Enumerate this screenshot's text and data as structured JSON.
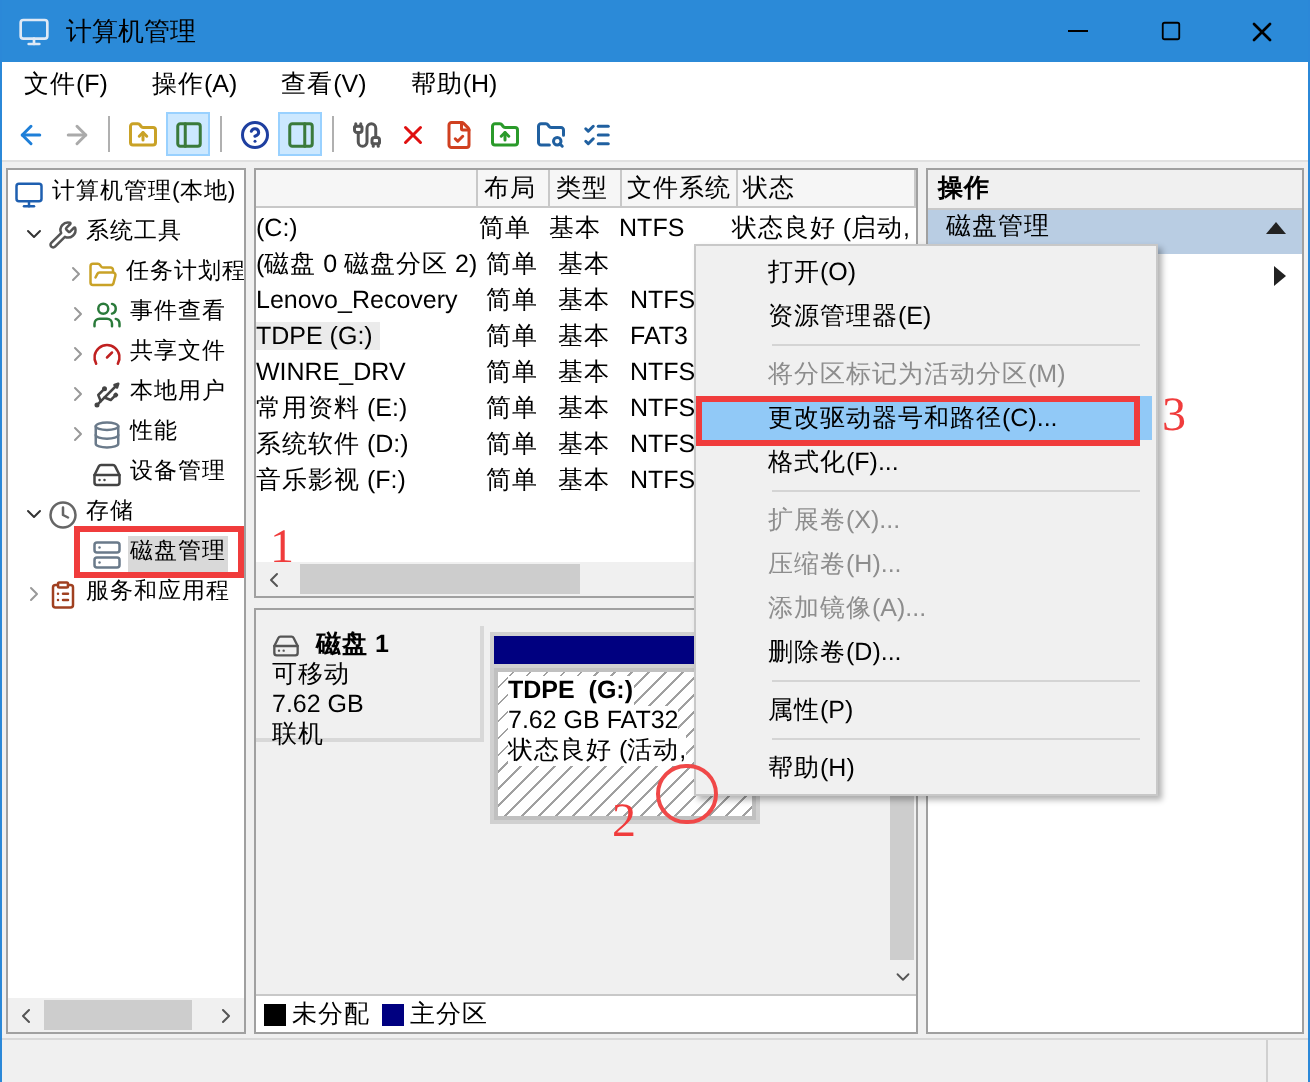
{
  "window": {
    "title": "计算机管理"
  },
  "menu_bar": [
    "文件(F)",
    "操作(A)",
    "查看(V)",
    "帮助(H)"
  ],
  "toolbar": [
    {
      "kind": "button",
      "pressed": false,
      "disabled": false
    },
    {
      "kind": "button",
      "pressed": false,
      "disabled": true
    },
    {
      "kind": "separator"
    },
    {
      "kind": "button",
      "pressed": false,
      "disabled": false
    },
    {
      "kind": "button",
      "pressed": true,
      "disabled": false
    },
    {
      "kind": "separator"
    },
    {
      "kind": "button",
      "pressed": false,
      "disabled": false
    },
    {
      "kind": "button",
      "pressed": true,
      "disabled": false
    },
    {
      "kind": "separator"
    },
    {
      "kind": "button",
      "pressed": false,
      "disabled": false
    },
    {
      "kind": "button",
      "pressed": false,
      "disabled": false
    },
    {
      "kind": "button",
      "pressed": false,
      "disabled": false
    },
    {
      "kind": "button",
      "pressed": false,
      "disabled": false
    },
    {
      "kind": "button",
      "pressed": false,
      "disabled": false
    },
    {
      "kind": "button",
      "pressed": false,
      "disabled": false
    }
  ],
  "tree": [
    {
      "label": "计算机管理(本地)",
      "kind": "root",
      "selected": false,
      "children": [
        {
          "label": "系统工具",
          "kind": "branch",
          "expanded": true,
          "selected": false,
          "children": [
            {
              "label": "任务计划程",
              "kind": "branch",
              "expanded": false,
              "selected": false
            },
            {
              "label": "事件查看",
              "kind": "branch",
              "expanded": false,
              "selected": false
            },
            {
              "label": "共享文件",
              "kind": "branch",
              "expanded": false,
              "selected": false
            },
            {
              "label": "本地用户",
              "kind": "branch",
              "expanded": false,
              "selected": false
            },
            {
              "label": "性能",
              "kind": "branch",
              "expanded": false,
              "selected": false
            },
            {
              "label": "设备管理",
              "kind": "leaf",
              "selected": false
            }
          ]
        },
        {
          "label": "存储",
          "kind": "branch",
          "expanded": true,
          "selected": false,
          "children": [
            {
              "label": "磁盘管理",
              "kind": "leaf",
              "selected": true
            }
          ]
        },
        {
          "label": "服务和应用程",
          "kind": "branch",
          "expanded": false,
          "selected": false
        }
      ]
    }
  ],
  "volume_list": {
    "columns": [
      "布局",
      "类型",
      "文件系统",
      "状态"
    ],
    "rows": [
      {
        "name": "(C:)",
        "layout": "简单",
        "type": "基本",
        "file_system": "NTFS",
        "status": "状态良好 (启动,",
        "selected": false
      },
      {
        "name": "(磁盘 0 磁盘分区 2)",
        "layout": "简单",
        "type": "基本",
        "selected": false
      },
      {
        "name": "Lenovo_Recovery",
        "layout": "简单",
        "type": "基本",
        "file_system": "NTFS",
        "selected": false
      },
      {
        "name": "TDPE (G:)",
        "layout": "简单",
        "type": "基本",
        "file_system": "FAT3",
        "selected": true
      },
      {
        "name": "WINRE_DRV",
        "layout": "简单",
        "type": "基本",
        "file_system": "NTFS",
        "selected": false
      },
      {
        "name": "常用资料 (E:)",
        "layout": "简单",
        "type": "基本",
        "file_system": "NTFS",
        "selected": false
      },
      {
        "name": "系统软件 (D:)",
        "layout": "简单",
        "type": "基本",
        "file_system": "NTFS",
        "selected": false
      },
      {
        "name": "音乐影视 (F:)",
        "layout": "简单",
        "type": "基本",
        "file_system": "NTFS",
        "selected": false
      }
    ]
  },
  "disk_view": {
    "disk": {
      "name": "磁盘 1",
      "lines": [
        "可移动",
        "7.62 GB",
        "联机"
      ]
    },
    "partitions": [
      {
        "name": "TDPE  (G:)",
        "lines": [
          "7.62 GB FAT32",
          "状态良好 (活动,"
        ],
        "color": "#000080"
      }
    ],
    "legend": [
      {
        "label": "未分配",
        "color": "#000000"
      },
      {
        "label": "主分区",
        "color": "#000080"
      }
    ]
  },
  "actions": {
    "title": "操作",
    "items": [
      {
        "kind": "section",
        "label": "磁盘管理"
      },
      {
        "kind": "more"
      }
    ]
  },
  "context_menu": [
    {
      "kind": "item",
      "label": "打开(O)",
      "disabled": false,
      "selected": false
    },
    {
      "kind": "item",
      "label": "资源管理器(E)",
      "disabled": false,
      "selected": false
    },
    {
      "kind": "separator"
    },
    {
      "kind": "item",
      "label": "将分区标记为活动分区(M)",
      "disabled": true,
      "selected": false
    },
    {
      "kind": "item",
      "label": "更改驱动器号和路径(C)...",
      "disabled": false,
      "selected": true
    },
    {
      "kind": "item",
      "label": "格式化(F)...",
      "disabled": false,
      "selected": false
    },
    {
      "kind": "separator"
    },
    {
      "kind": "item",
      "label": "扩展卷(X)...",
      "disabled": true,
      "selected": false
    },
    {
      "kind": "item",
      "label": "压缩卷(H)...",
      "disabled": true,
      "selected": false
    },
    {
      "kind": "item",
      "label": "添加镜像(A)...",
      "disabled": true,
      "selected": false
    },
    {
      "kind": "item",
      "label": "删除卷(D)...",
      "disabled": false,
      "selected": false
    },
    {
      "kind": "separator"
    },
    {
      "kind": "item",
      "label": "属性(P)",
      "disabled": false,
      "selected": false
    },
    {
      "kind": "separator"
    },
    {
      "kind": "item",
      "label": "帮助(H)",
      "disabled": false,
      "selected": false
    }
  ],
  "annotations": [
    {
      "label": "1"
    },
    {
      "label": "2"
    },
    {
      "label": "3"
    }
  ]
}
